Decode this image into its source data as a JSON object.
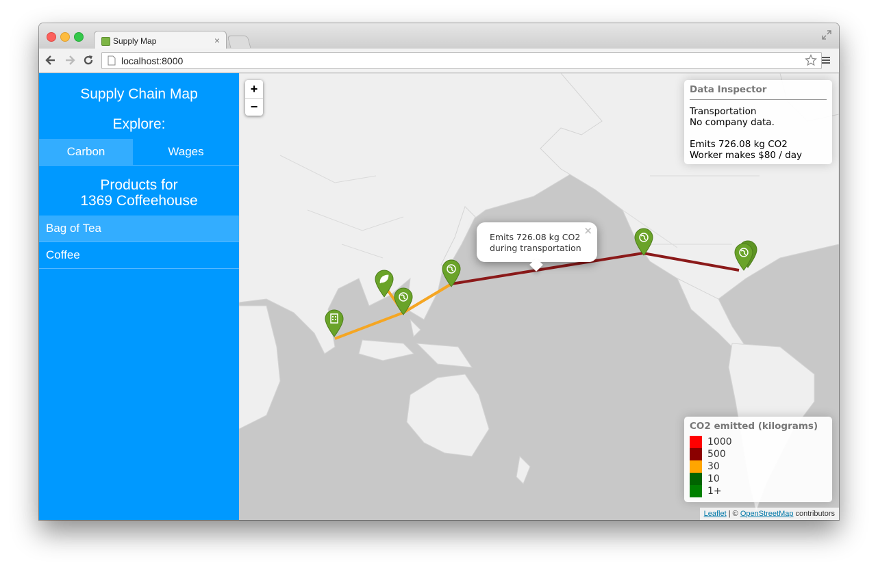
{
  "browser": {
    "tab_title": "Supply Map",
    "url": "localhost:8000"
  },
  "sidebar": {
    "title": "Supply Chain Map",
    "explore_label": "Explore:",
    "tabs": [
      {
        "label": "Carbon",
        "active": true
      },
      {
        "label": "Wages",
        "active": false
      }
    ],
    "products_heading_line1": "Products for",
    "products_heading_line2": "1369 Coffeehouse",
    "products": [
      {
        "label": "Bag of Tea",
        "active": true
      },
      {
        "label": "Coffee",
        "active": false
      }
    ]
  },
  "map": {
    "zoom_in": "+",
    "zoom_out": "−",
    "inspector": {
      "title": "Data Inspector",
      "line1": "Transportation",
      "line2": "No company data.",
      "line3": "Emits 726.08 kg CO2",
      "line4": "Worker makes $80 / day"
    },
    "popup": {
      "line1": "Emits 726.08 kg CO2",
      "line2": "during transportation",
      "close": "×"
    },
    "legend": {
      "title": "CO2 emitted (kilograms)",
      "items": [
        {
          "label": "1000",
          "color": "#ff0000"
        },
        {
          "label": "500",
          "color": "#8b0000"
        },
        {
          "label": "30",
          "color": "#ffa500"
        },
        {
          "label": "10",
          "color": "#006400"
        },
        {
          "label": "1+",
          "color": "#008000"
        }
      ]
    },
    "attribution": {
      "leaflet": "Leaflet",
      "separator": " | © ",
      "osm": "OpenStreetMap",
      "suffix": " contributors"
    },
    "route_colors": {
      "high": "#8b1a1a",
      "medium": "#f5a623"
    },
    "marker_color": "#6aa329",
    "markers": [
      {
        "icon": "building-icon"
      },
      {
        "icon": "leaf-icon"
      },
      {
        "icon": "globe-icon"
      },
      {
        "icon": "globe-icon"
      },
      {
        "icon": "globe-icon"
      },
      {
        "icon": "globe-icon"
      }
    ]
  }
}
